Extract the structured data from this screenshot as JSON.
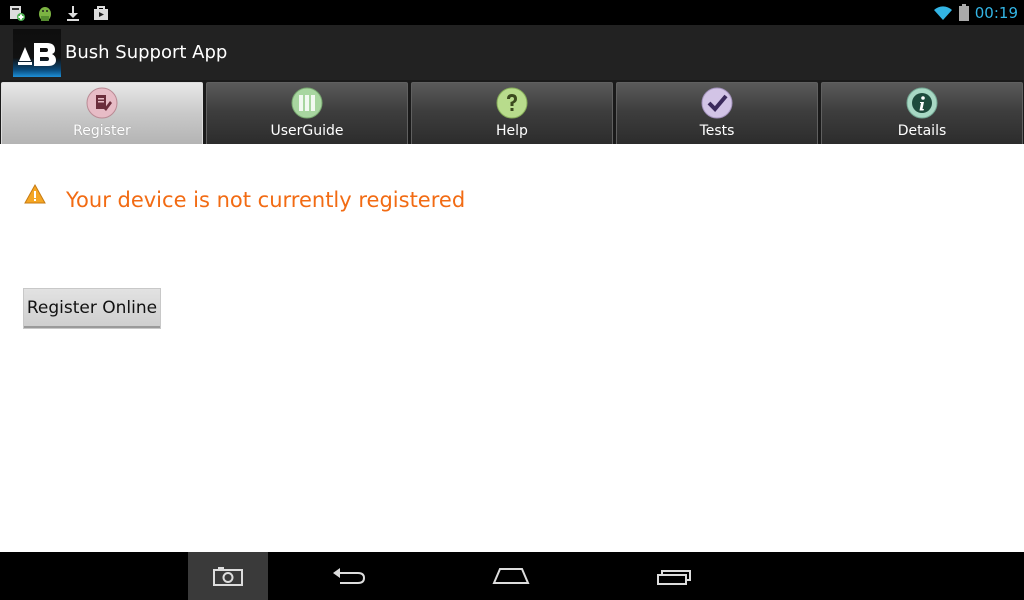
{
  "status_bar": {
    "clock": "00:19",
    "left_icons": [
      "app-install-icon",
      "android-debug-icon",
      "download-icon",
      "store-icon"
    ],
    "right_icons": [
      "wifi-icon",
      "battery-icon"
    ],
    "clock_color": "#33b5e5"
  },
  "action_bar": {
    "title": "Bush Support App",
    "logo_icon": "bush-logo-icon"
  },
  "tabs": [
    {
      "label": "Register",
      "icon": "register-icon",
      "selected": true
    },
    {
      "label": "UserGuide",
      "icon": "userguide-icon",
      "selected": false
    },
    {
      "label": "Help",
      "icon": "help-icon",
      "selected": false
    },
    {
      "label": "Tests",
      "icon": "tests-icon",
      "selected": false
    },
    {
      "label": "Details",
      "icon": "details-icon",
      "selected": false
    }
  ],
  "content": {
    "warning_icon": "warning-icon",
    "warning_text": "Your device is not currently registered",
    "warning_color": "#f26b13",
    "register_button_label": "Register Online"
  },
  "nav_bar": {
    "buttons": [
      "screenshot-icon",
      "back-icon",
      "home-icon",
      "recents-icon"
    ]
  }
}
